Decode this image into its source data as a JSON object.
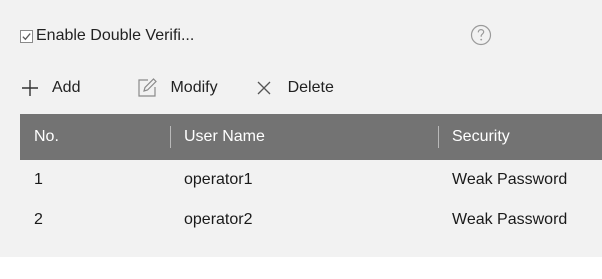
{
  "options": {
    "enable_double_verification_label": "Enable Double Verifi...",
    "enable_double_verification_checked": true
  },
  "icons": {
    "help": "help-circle-icon",
    "add": "plus-icon",
    "modify": "edit-icon",
    "delete": "close-x-icon",
    "checkbox": "check-icon"
  },
  "toolbar": {
    "add_label": "Add",
    "modify_label": "Modify",
    "delete_label": "Delete"
  },
  "table": {
    "headers": [
      "No.",
      "User Name",
      "Security"
    ],
    "rows": [
      [
        "1",
        "operator1",
        "Weak Password"
      ],
      [
        "2",
        "operator2",
        "Weak Password"
      ]
    ]
  },
  "colors": {
    "header_bg": "#737373",
    "header_text": "#ffffff",
    "page_bg": "#f2f2f2"
  }
}
